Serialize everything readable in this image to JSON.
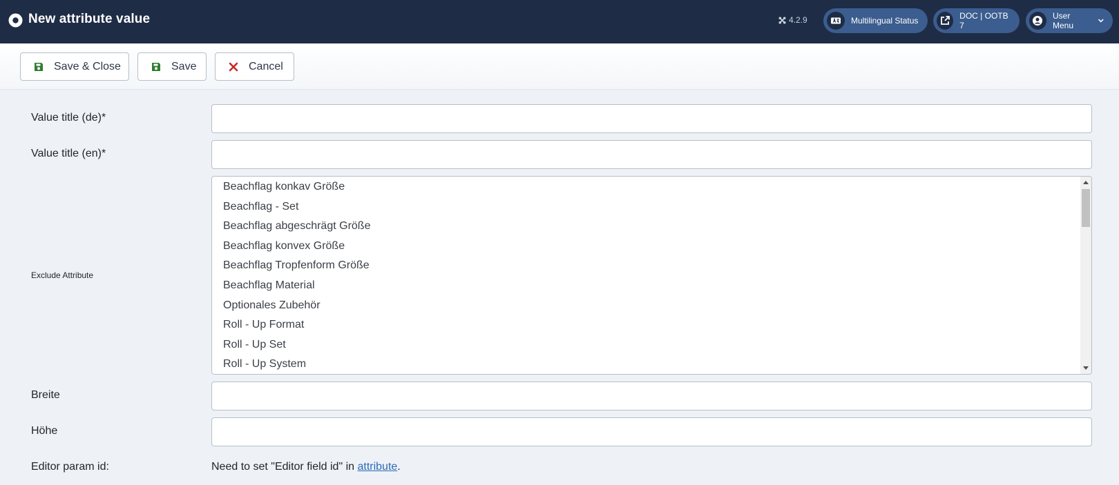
{
  "header": {
    "title": "New attribute value",
    "version": "4.2.9",
    "multilingual_label": "Multilingual Status",
    "doc_label": "DOC | OOTB 7",
    "user_menu_label": "User Menu"
  },
  "toolbar": {
    "save_close_label": "Save & Close",
    "save_label": "Save",
    "cancel_label": "Cancel"
  },
  "form": {
    "title_de_label": "Value title (de)*",
    "title_en_label": "Value title (en)*",
    "exclude_label": "Exclude Attribute",
    "exclude_options": [
      "Beachflag konkav Größe",
      "Beachflag - Set",
      "Beachflag abgeschrägt Größe",
      "Beachflag konvex Größe",
      "Beachflag Tropfenform Größe",
      "Beachflag Material",
      "Optionales Zubehör",
      "Roll - Up Format",
      "Roll - Up Set",
      "Roll - Up System"
    ],
    "breite_label": "Breite",
    "hoehe_label": "Höhe",
    "editor_param_label": "Editor param id:",
    "editor_note_prefix": "Need to set \"Editor field id\" in ",
    "editor_note_link": "attribute",
    "editor_note_suffix": "."
  },
  "colors": {
    "header_bg": "#1f2c46",
    "pill_bg": "#3b5d8f",
    "page_bg": "#eef2f7",
    "save_icon": "#2f7d32",
    "cancel_icon": "#c52827",
    "link": "#2a69b8"
  },
  "icons": {
    "logo": "joomla-circle-icon",
    "version": "joomla-icon",
    "multilingual": "language-icon",
    "doc": "external-link-icon",
    "user": "user-circle-icon",
    "user_chevron": "chevron-down-icon",
    "save": "floppy-disk-icon",
    "cancel": "times-icon"
  }
}
